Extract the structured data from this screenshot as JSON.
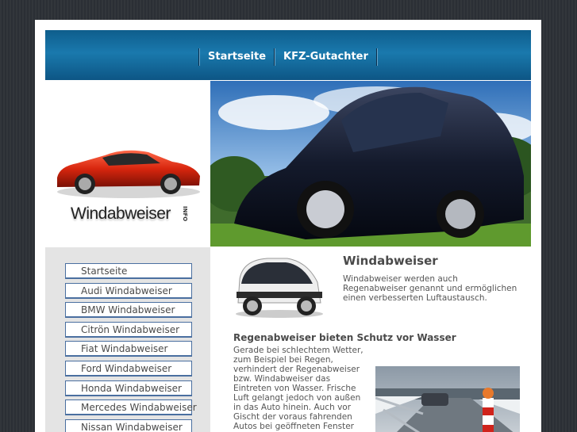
{
  "header": {
    "nav": [
      {
        "label": "Startseite"
      },
      {
        "label": "KFZ-Gutachter"
      }
    ]
  },
  "logo": {
    "text": "Windabweiser",
    "suffix": "INFO"
  },
  "sidebar": {
    "items": [
      {
        "label": "Startseite"
      },
      {
        "label": "Audi Windabweiser"
      },
      {
        "label": "BMW Windabweiser"
      },
      {
        "label": "Citrön Windabweiser"
      },
      {
        "label": "Fiat Windabweiser"
      },
      {
        "label": "Ford Windabweiser"
      },
      {
        "label": "Honda Windabweiser"
      },
      {
        "label": "Mercedes Windabweiser"
      },
      {
        "label": "Nissan Windabweiser"
      }
    ]
  },
  "main": {
    "title": "Windabweiser",
    "intro": "Windabweiser werden auch Regenabweiser genannt und ermöglichen einen verbesserten Luftaustausch.",
    "section_title": "Regenabweiser bieten Schutz vor Wasser",
    "section_text": "Gerade bei schlechtem Wetter, zum Beispiel bei Regen, verhindert der Regenabweiser bzw. Windabweiser das Eintreten von Wasser. Frische Luft gelangt jedoch von außen in das Auto hinein. Auch vor Gischt der voraus fahrenden Autos bei geöffneten Fenster schützt der Windabweiser."
  },
  "colors": {
    "header": "#1a79ad",
    "sidebar_bg": "#e4e4e4",
    "menu_border": "#4a6fa0",
    "page_bg": "#2b2f35"
  },
  "icons": {
    "logo_car": "red-sports-car-icon",
    "hero": "black-hatchback-photo",
    "content_car": "smart-car-photo",
    "winter": "winter-road-photo"
  }
}
